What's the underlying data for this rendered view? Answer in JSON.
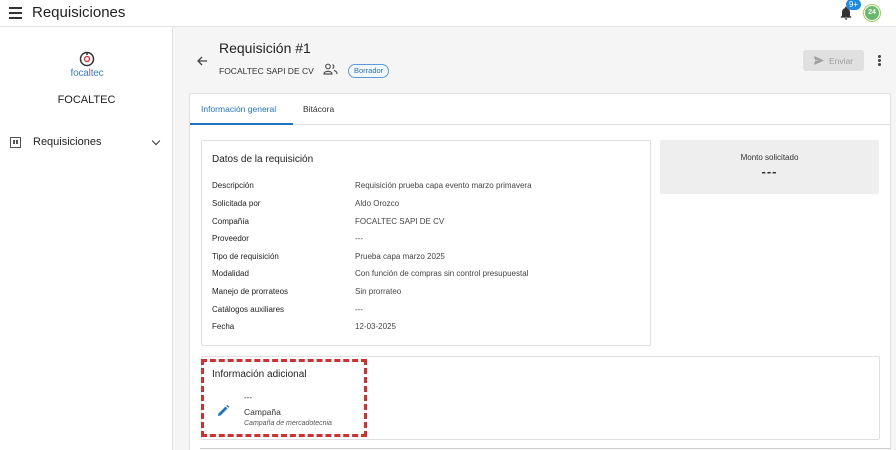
{
  "app": {
    "title": "Requisiciones",
    "notification_count": "9+",
    "avatar_initials": "24"
  },
  "sidebar": {
    "logo_text_prefix": "foca",
    "logo_text_highlight": "l",
    "logo_text_suffix": "tec",
    "company": "FOCALTEC",
    "items": [
      {
        "label": "Requisiciones",
        "icon": "report-icon"
      }
    ]
  },
  "header": {
    "title": "Requisición #1",
    "company": "FOCALTEC SAPI DE CV",
    "status": "Borrador",
    "send_label": "Enviar"
  },
  "tabs": [
    {
      "label": "Información general",
      "active": true
    },
    {
      "label": "Bitácora",
      "active": false
    }
  ],
  "datos": {
    "title": "Datos de la requisición",
    "rows": [
      {
        "key": "Descripción",
        "value": "Requisición prueba capa evento marzo primavera"
      },
      {
        "key": "Solicitada por",
        "value": "Aldo Orozco"
      },
      {
        "key": "Compañía",
        "value": "FOCALTEC SAPI DE CV"
      },
      {
        "key": "Proveedor",
        "value": "---"
      },
      {
        "key": "Tipo de requisición",
        "value": "Prueba capa marzo 2025"
      },
      {
        "key": "Modalidad",
        "value": "Con función de compras sin control presupuestal"
      },
      {
        "key": "Manejo de prorrateos",
        "value": "Sin prorrateo"
      },
      {
        "key": "Catálogos auxiliares",
        "value": "---"
      },
      {
        "key": "Fecha",
        "value": "12-03-2025"
      }
    ]
  },
  "monto": {
    "label": "Monto solicitado",
    "value": "---"
  },
  "info_adicional": {
    "title": "Información adicional",
    "value": "---",
    "field_name": "Campaña",
    "field_description": "Campaña de mercadotecnia"
  },
  "colors": {
    "accent": "#1f74c2",
    "highlight": "#d32f2f",
    "badge_border": "#5b9bd5"
  }
}
